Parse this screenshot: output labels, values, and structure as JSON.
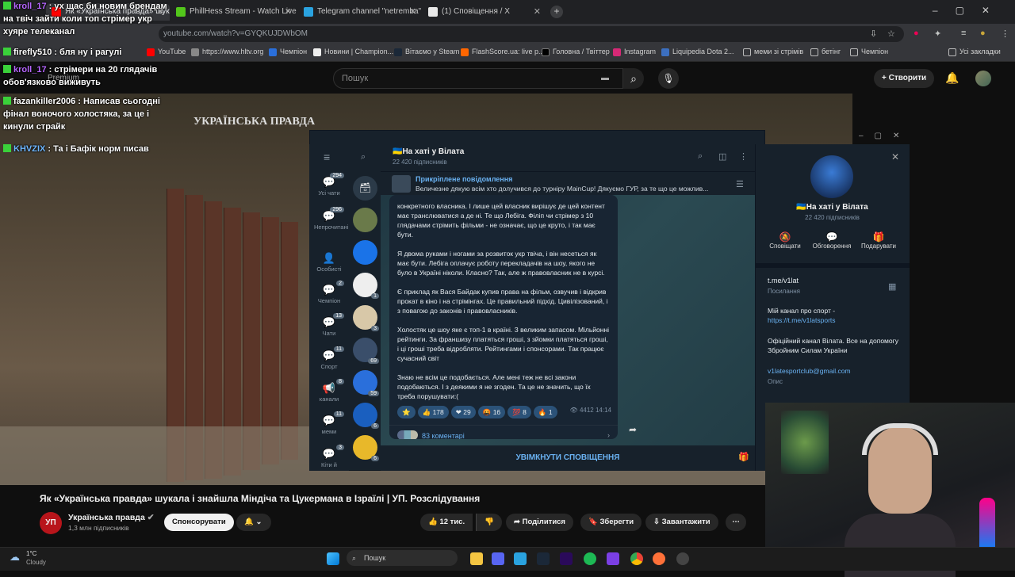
{
  "browser": {
    "tabs": [
      {
        "label": "Як «Українська правда» шукала",
        "color": "#ff0000"
      },
      {
        "label": "PhillHess Stream - Watch Live",
        "color": "#53c71b"
      },
      {
        "label": "Telegram channel \"netremba\"",
        "color": "#2aa3e0"
      },
      {
        "label": "(1) Сповіщення / X",
        "color": "#e8e8e8"
      }
    ],
    "address": "youtube.com/watch?v=GYQKUJDWbOM",
    "bookmarks": [
      "YouTube",
      "https://www.hltv.org",
      "Чемпіон",
      "Новини | Champion...",
      "Вітаємо у Steam",
      "FlashScore.ua: live р...",
      "Головна / Твіттер",
      "Instagram",
      "Liquipedia Dota 2...",
      "меми зі стрімів",
      "бетінг",
      "Чемпіон",
      "Усі закладки"
    ]
  },
  "youtube": {
    "logo_text": "Premium",
    "search_placeholder": "Пошук",
    "create_label": "Створити",
    "video_overlay_title": "УКРАЇНСЬКА ПРАВДА",
    "video_title": "Як «Українська правда» шукала і знайшла Міндіча та Цукермана в Ізраїлі | УП. Розслідування",
    "channel_avatar_text": "УП",
    "channel_name": "Українська правда",
    "channel_subs": "1,3 млн підписників",
    "sponsor_label": "Спонсорувати",
    "likes": "12 тис.",
    "share_label": "Поділитися",
    "save_label": "Зберегти",
    "download_label": "Завантажити"
  },
  "chat": [
    {
      "user": "kroll_17",
      "color": "#b666ff",
      "text": "ух щас би новим брендам на твіч зайти коли топ стрімер укр хуяре телеканал"
    },
    {
      "user": "firefly510",
      "color": "#ffffff",
      "text": "бля ну і рагулі"
    },
    {
      "user": "kroll_17",
      "color": "#b666ff",
      "text": "стрімери на 20 глядачів обов'язково виживуть"
    },
    {
      "user": "fazankiller2006",
      "color": "#ffffff",
      "text": "Написав сьогодні фінал воночого холостяка, за це і кинули страйк"
    },
    {
      "user": "KHVZIX",
      "color": "#6fb7ff",
      "text": "Та і Бафік норм писав"
    }
  ],
  "telegram": {
    "channel_name": "На хаті у Вілата",
    "channel_subs": "22 420 підписників",
    "nav": [
      {
        "label": "Усі чати",
        "badge": "294"
      },
      {
        "label": "Непрочитані",
        "badge": "296"
      },
      {
        "label": "Особисті",
        "badge": ""
      },
      {
        "label": "Чемпіон",
        "badge": "2"
      },
      {
        "label": "Чати",
        "badge": "13"
      },
      {
        "label": "Спорт",
        "badge": "11"
      },
      {
        "label": "канали",
        "badge": "8"
      },
      {
        "label": "меми",
        "badge": "11"
      },
      {
        "label": "Кіти й",
        "badge": "3"
      }
    ],
    "chat_badges": [
      "",
      "",
      "",
      "1",
      "3",
      "69",
      "59",
      "6",
      "6"
    ],
    "pinned_title": "Прикріплене повідомлення",
    "pinned_text": "Величезне дякую всім хто долучився до турніру MainCup! Дякуємо ГУР, за те що це можлив...",
    "message": [
      "конкретного власника. І лише цей власник вирішує де цей контент має транслюватися а де ні. Те що Лебіга. Філіп чи стрімер з 10 глядачами стрімить фільми - не означає, що це круто, і так має бути.",
      "Я двома руками і ногами за розвиток укр твіча, і він несеться як має бути. Лебіга оплачує роботу перекладачів на шоу, якого не було в Україні ніколи. Класно? Так, але ж правовласник не в курсі.",
      "Є приклад як Вася Байдак купив права на фільм, озвучив і відкрив прокат в кіно і на стрімінгах. Це правильний підхід. Цивілізований, і з повагою до законів і правовласників.",
      "Холостяк це шоу яке є топ-1 в країні. З великим запасом. Мільйонні рейтинги. За франшизу платяться гроші, з зйомки платяться гроші, і ці гроші треба відробляти. Рейтингами і спонсорами. Так працює сучасний світ",
      "Знаю не всім це подобається. Але мені теж не всі закони подобаються. І з деякими я не згоден. Та це не значить, що їх треба порушувати:("
    ],
    "reactions": [
      {
        "emoji": "⭐",
        "count": ""
      },
      {
        "emoji": "👍",
        "count": "178"
      },
      {
        "emoji": "❤",
        "count": "29"
      },
      {
        "emoji": "🤬",
        "count": "16"
      },
      {
        "emoji": "💯",
        "count": "8"
      },
      {
        "emoji": "🔥",
        "count": "1"
      }
    ],
    "views": "4412",
    "time": "14:14",
    "comments": "83 коментарі",
    "footer": "УВІМКНУТИ СПОВІЩЕННЯ",
    "actions": [
      "Сповіщати",
      "Обговорення",
      "Подарувати"
    ],
    "link": "t.me/v1lat",
    "link_caption": "Посилання",
    "about_1": "Мій канал про спорт -",
    "about_1_link": "https://t.me/v1latsports",
    "about_2": "Офіційний канал Вілата. Все на допомогу Збройним Силам України",
    "email": "v1latesportclub@gmail.com",
    "desc_caption": "Опис"
  },
  "taskbar": {
    "temp": "1°C",
    "weather": "Cloudy",
    "search": "Пошук"
  }
}
